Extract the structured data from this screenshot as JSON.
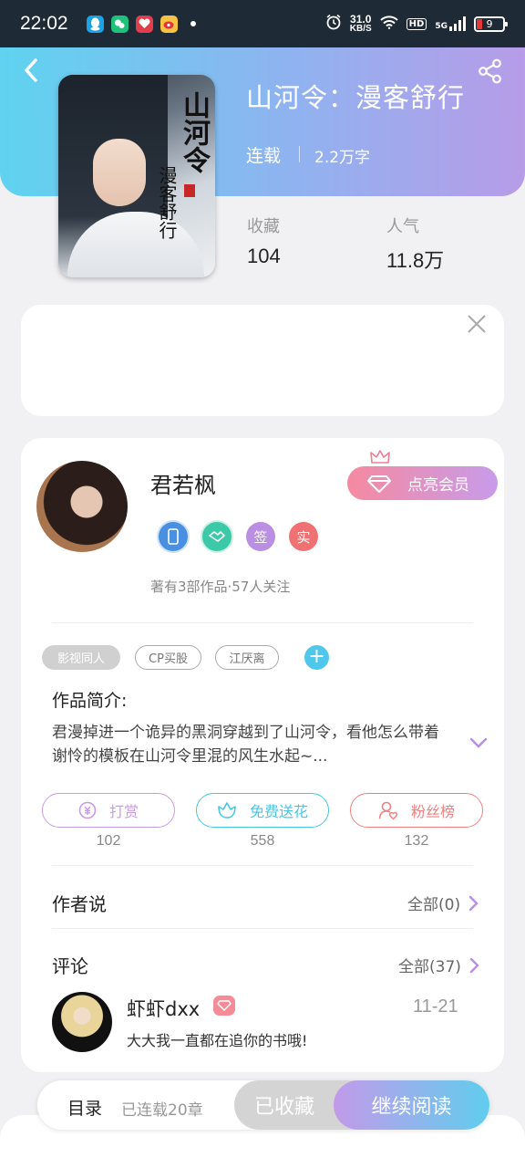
{
  "status_bar": {
    "time": "22:02",
    "net_speed_value": "31.0",
    "net_speed_unit": "KB/S",
    "hd": "HD",
    "network": "5G",
    "battery": "9"
  },
  "book": {
    "title": "山河令：漫客舒行",
    "status": "连载",
    "word_count": "2.2万字",
    "cover_title": "山河令",
    "cover_subtitle": "漫客舒行"
  },
  "stats": [
    {
      "label": "收藏",
      "value": "104"
    },
    {
      "label": "人气",
      "value": "11.8万"
    }
  ],
  "author": {
    "name": "君若枫",
    "member_button": "点亮会员",
    "badges": [
      {
        "icon": "phone-badge-icon",
        "text": "",
        "color": "#4a90e2"
      },
      {
        "icon": "handshake-badge-icon",
        "text": "",
        "color": "#3cc9a8"
      },
      {
        "icon": "sign-badge-icon",
        "text": "签",
        "color": "#b98ee3"
      },
      {
        "icon": "verified-badge-icon",
        "text": "实",
        "color": "#f07171"
      }
    ],
    "meta": "著有3部作品·57人关注"
  },
  "tags": [
    "影视同人",
    "CP买股",
    "江厌离"
  ],
  "intro": {
    "label": "作品简介:",
    "text": "君漫掉进一个诡异的黑洞穿越到了山河令，看他怎么带着谢怜的模板在山河令里混的风生水起~..."
  },
  "actions": [
    {
      "label": "打赏",
      "count": "102",
      "color": "#c79be8"
    },
    {
      "label": "免费送花",
      "count": "558",
      "color": "#45c8e4"
    },
    {
      "label": "粉丝榜",
      "count": "132",
      "color": "#f08080"
    }
  ],
  "author_says": {
    "title": "作者说",
    "link": "全部(0)"
  },
  "comments": {
    "title": "评论",
    "link": "全部(37)",
    "items": [
      {
        "user": "虾虾dxx",
        "date": "11-21",
        "text": "大大我一直都在追你的书哦!"
      }
    ]
  },
  "bottom_bar": {
    "toc": "目录",
    "chapters": "已连载20章",
    "collected": "已收藏",
    "continue": "继续阅读"
  },
  "colors": {
    "accent_cyan": "#5fd3f0",
    "accent_purple": "#b79ce8",
    "member_pink": "#f58aa0"
  }
}
